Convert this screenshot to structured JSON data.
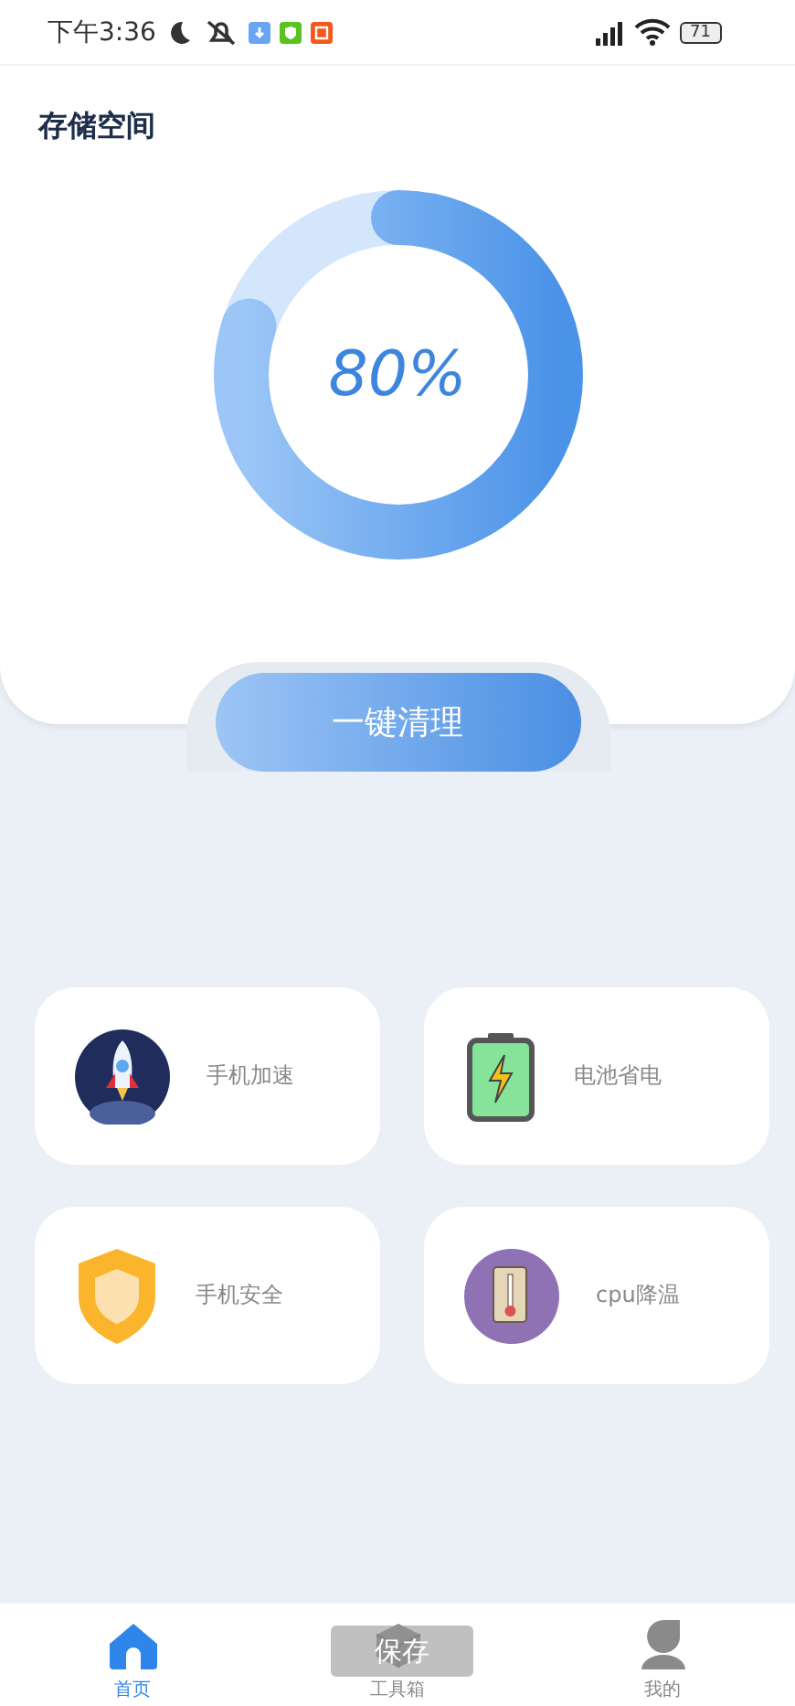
{
  "status_bar": {
    "time": "下午3:36",
    "battery": "71"
  },
  "storage": {
    "title": "存储空间",
    "level": 0.8,
    "reading": "80%"
  },
  "clean_button": {
    "label": "一键清理"
  },
  "tools": [
    {
      "kind": "rocket",
      "label": "手机加速"
    },
    {
      "kind": "battery",
      "label": "电池省电"
    },
    {
      "kind": "shield",
      "label": "手机安全"
    },
    {
      "kind": "thermometer",
      "label": "cpu降温"
    }
  ],
  "tab_bar": [
    {
      "kind": "home",
      "label": "首页",
      "selected": true
    },
    {
      "kind": "box",
      "label": "工具箱",
      "selected": false
    },
    {
      "kind": "person",
      "label": "我的",
      "selected": false
    }
  ],
  "toast": "保存"
}
